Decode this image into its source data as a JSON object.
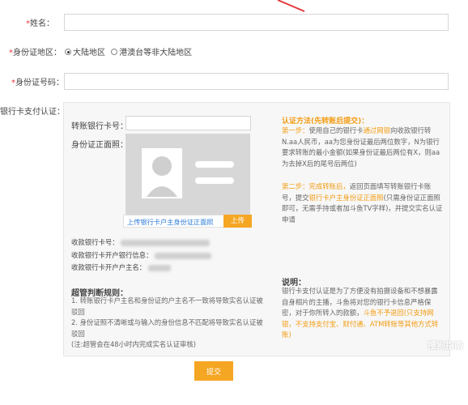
{
  "form": {
    "name_label": "姓名：",
    "region_label": "身份证地区：",
    "region_options": [
      "大陆地区",
      "港澳台等非大陆地区"
    ],
    "id_label": "身份证号码：",
    "bank_label": "银行卡支付认证："
  },
  "panel": {
    "card_no_label": "转账银行卡号：",
    "id_front_label": "身份证正面照：",
    "upload_hint": "上传银行卡户主身份证正面照",
    "upload_button": "上传",
    "recv_card_label": "收款银行卡号：",
    "recv_bank_label": "收款银行卡开户银行信息：",
    "recv_name_label": "收款银行卡开户户主名：",
    "rules_title": "超管判断规则：",
    "rules": [
      "1. 转账银行卡户主名和身份证的户主名不一致将导致实名认证被驳回",
      "2. 身份证照不清晰或与输入的身份信息不匹配将导致实名认证被驳回",
      "(注:超管会在48小时内完成实名认证审核)"
    ],
    "method_title": "认证方法(先转账后提交)：",
    "step1_prefix": "第一步：",
    "step1_a": "使用自己的银行卡",
    "step1_link": "通过网银",
    "step1_b": "向收款银行转N.aa人民币，aa为您身份证最后两位数字，N为银行要求转账的最小金额(如果身份证最后两位有X，则aa为去掉X后的尾号后两位)",
    "step2_prefix": "第二步：完成转账后，",
    "step2_a": "返回页面填写转账银行卡账号，提交",
    "step2_link": "银行卡户主身份证正面照",
    "step2_b": "(只需身份证正面照即可，无需手持或者加斗鱼TV字样)，并提交实名认证申请",
    "note_title": "说明：",
    "note_text": "银行卡支付认证是为了方便没有拍摄设备和不想暴露自身相片的主播，斗鱼将对您的银行卡信息严格保密，对于你所转入的款额，",
    "note_highlight": "斗鱼不予退回(只支持网银，不支持支付宝、财付通、ATM转账等其他方式转账)"
  },
  "submit_label": "提交",
  "watermark": "搜狗指南",
  "colors": {
    "accent": "#f5a623",
    "link": "#2e7dd7",
    "required": "#e4393c"
  }
}
